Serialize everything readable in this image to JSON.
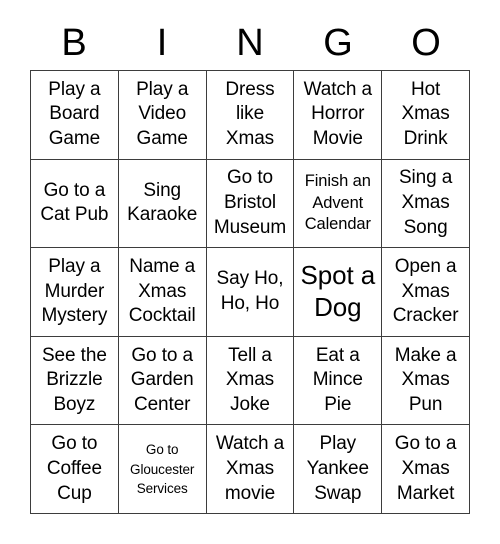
{
  "card": {
    "header_letters": [
      "B",
      "I",
      "N",
      "G",
      "O"
    ],
    "grid_rows": 5,
    "grid_cols": 5,
    "text_color": "#000000",
    "border_color": "#3d3d3d",
    "background_color": "#ffffff",
    "cells": [
      {
        "text": "Play a Board Game",
        "size": "normal"
      },
      {
        "text": "Play a Video Game",
        "size": "normal"
      },
      {
        "text": "Dress like Xmas",
        "size": "normal"
      },
      {
        "text": "Watch a Horror Movie",
        "size": "normal"
      },
      {
        "text": "Hot Xmas Drink",
        "size": "normal"
      },
      {
        "text": "Go to a Cat Pub",
        "size": "normal"
      },
      {
        "text": "Sing Karaoke",
        "size": "normal"
      },
      {
        "text": "Go to Bristol Museum",
        "size": "normal"
      },
      {
        "text": "Finish an Advent Calendar",
        "size": "small"
      },
      {
        "text": "Sing a Xmas Song",
        "size": "normal"
      },
      {
        "text": "Play a Murder Mystery",
        "size": "normal"
      },
      {
        "text": "Name a Xmas Cocktail",
        "size": "normal"
      },
      {
        "text": "Say Ho, Ho, Ho",
        "size": "normal"
      },
      {
        "text": "Spot a Dog",
        "size": "free"
      },
      {
        "text": "Open a Xmas Cracker",
        "size": "normal"
      },
      {
        "text": "See the Brizzle Boyz",
        "size": "normal"
      },
      {
        "text": "Go to a Garden Center",
        "size": "normal"
      },
      {
        "text": "Tell a Xmas Joke",
        "size": "normal"
      },
      {
        "text": "Eat a Mince Pie",
        "size": "normal"
      },
      {
        "text": "Make a Xmas Pun",
        "size": "normal"
      },
      {
        "text": "Go to Coffee Cup",
        "size": "normal"
      },
      {
        "text": "Go to Gloucester Services",
        "size": "xsmall"
      },
      {
        "text": "Watch a Xmas movie",
        "size": "normal"
      },
      {
        "text": "Play Yankee Swap",
        "size": "normal"
      },
      {
        "text": "Go to a Xmas Market",
        "size": "normal"
      }
    ]
  }
}
